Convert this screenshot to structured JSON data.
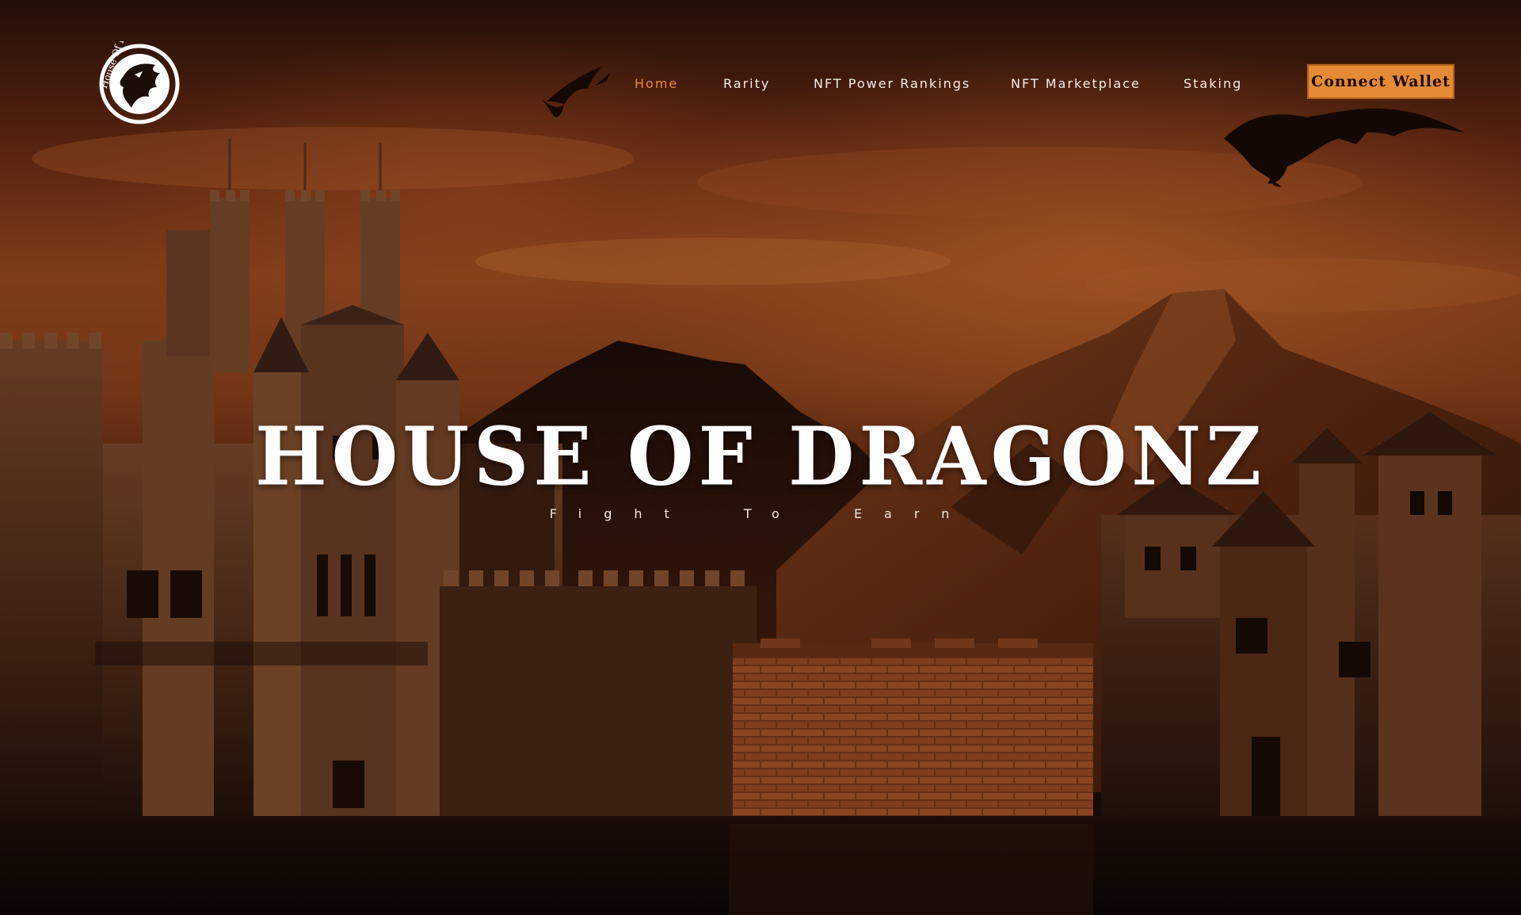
{
  "brand": {
    "logo_text": "House Of Dragonz",
    "logo_icon": "dragon-head-icon"
  },
  "nav": {
    "items": [
      {
        "label": "Home",
        "active": true
      },
      {
        "label": "Rarity",
        "active": false
      },
      {
        "label": "NFT Power Rankings",
        "active": false
      },
      {
        "label": "NFT Marketplace",
        "active": false
      },
      {
        "label": "Staking",
        "active": false
      }
    ],
    "connect_label": "Connect Wallet"
  },
  "hero": {
    "title": "HOUSE OF DRAGONZ",
    "subtitle": "Fight  To  Earn"
  },
  "colors": {
    "accent": "#e8873a",
    "button_bg": "#e58a35",
    "text": "#ffffff"
  },
  "icons": [
    "dragon-head-icon",
    "flying-dragon-icon",
    "castle-illustration",
    "mountain-illustration",
    "brick-wall-illustration"
  ]
}
